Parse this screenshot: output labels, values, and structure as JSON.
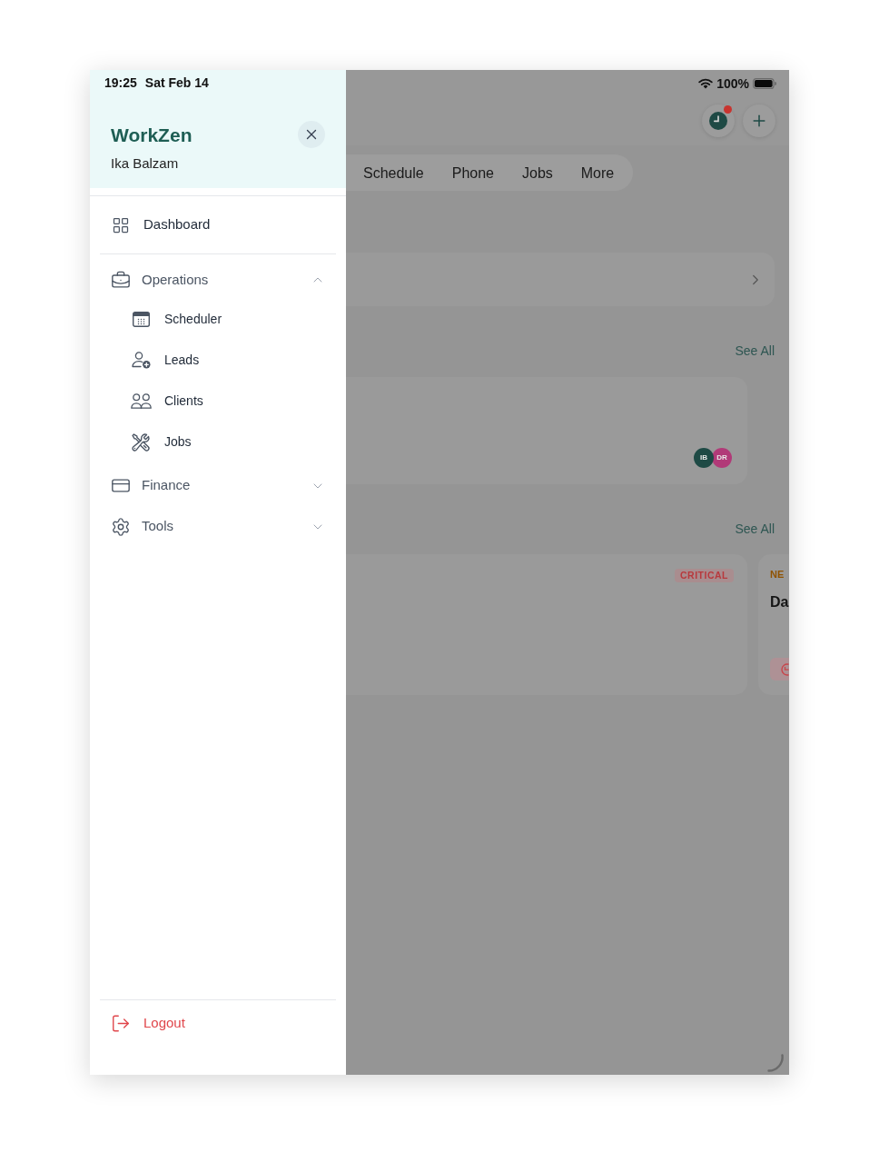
{
  "sidebar": {
    "status": {
      "time": "19:25",
      "date": "Sat Feb 14"
    },
    "brand": "WorkZen",
    "user": "Ika Balzam",
    "nav": [
      {
        "kind": "link",
        "label": "Dashboard"
      },
      {
        "kind": "group",
        "label": "Operations",
        "expanded": true,
        "children": [
          {
            "label": "Scheduler"
          },
          {
            "label": "Leads"
          },
          {
            "label": "Clients"
          },
          {
            "label": "Jobs"
          }
        ]
      },
      {
        "kind": "group",
        "label": "Finance",
        "expanded": false
      },
      {
        "kind": "group",
        "label": "Tools",
        "expanded": false
      }
    ],
    "logout": "Logout"
  },
  "app": {
    "status": {
      "battery": "100%"
    },
    "header": {
      "notification_dot": true
    },
    "tabs": [
      "Schedule",
      "Phone",
      "Jobs",
      "More"
    ],
    "sections": [
      {
        "kind": "link_card"
      },
      {
        "kind": "team",
        "link": "See All",
        "avatars": [
          {
            "initials": "IB",
            "color": "#1e4a45"
          },
          {
            "initials": "DR",
            "color": "#b13a78"
          }
        ]
      },
      {
        "kind": "jobs",
        "link": "See All",
        "cards": [
          {
            "tag": "CRITICAL",
            "color": "#b8393d"
          },
          {
            "tag": "NE",
            "color": "#8f5200",
            "title": "Da",
            "timer_button": true
          }
        ]
      }
    ]
  }
}
